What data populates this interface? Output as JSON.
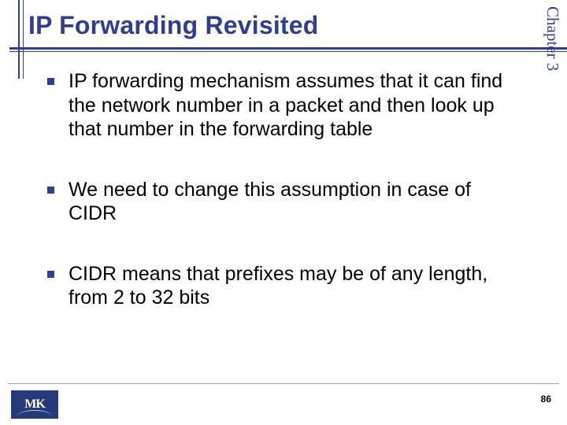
{
  "slide": {
    "title": "IP Forwarding Revisited",
    "side_label": "Chapter 3",
    "bullets": [
      "IP forwarding mechanism assumes that it can find the network number in a packet and then look up that number in the forwarding table",
      "We need to change this assumption in case of CIDR",
      "CIDR means that prefixes may be of any length, from 2 to 32 bits"
    ],
    "page_number": "86",
    "logo_text": "MK"
  }
}
